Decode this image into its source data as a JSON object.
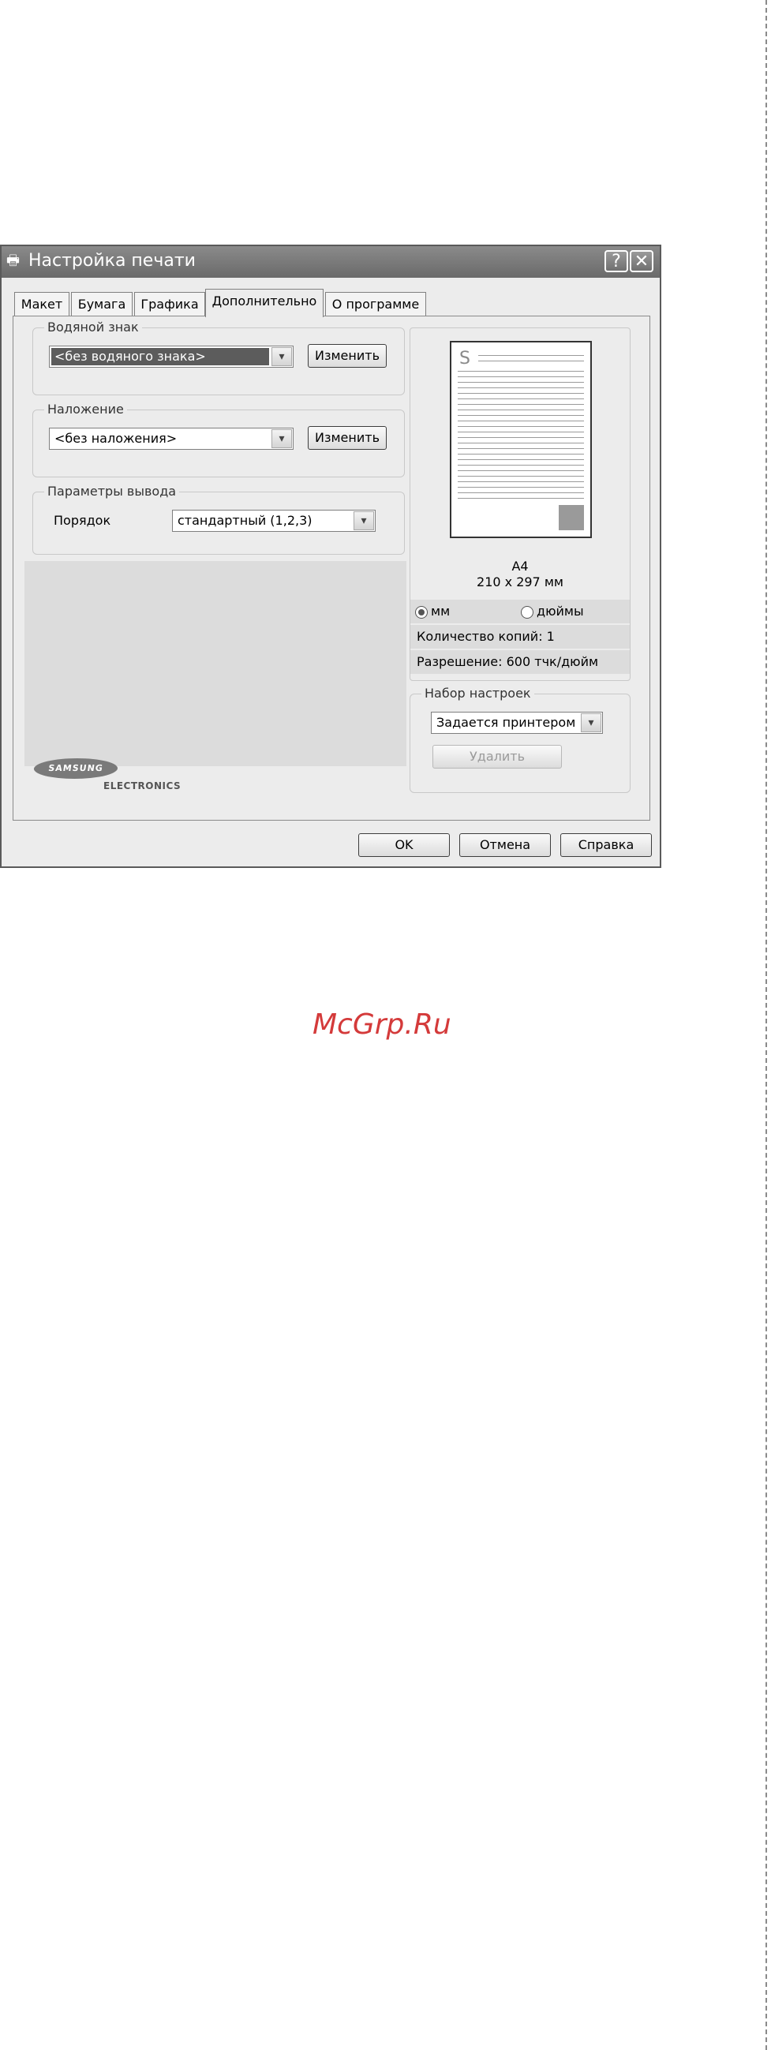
{
  "window": {
    "title": "Настройка печати",
    "help_button": "?",
    "close_button": "✕"
  },
  "tabs": [
    {
      "label": "Макет"
    },
    {
      "label": "Бумага"
    },
    {
      "label": "Графика"
    },
    {
      "label": "Дополнительно",
      "active": true
    },
    {
      "label": "О программе"
    }
  ],
  "watermark_group": {
    "label": "Водяной знак",
    "value": "<без водяного знака>",
    "edit_button": "Изменить"
  },
  "overlay_group": {
    "label": "Наложение",
    "value": "<без наложения>",
    "edit_button": "Изменить"
  },
  "output_group": {
    "label": "Параметры вывода",
    "order_label": "Порядок",
    "order_value": "стандартный (1,2,3)"
  },
  "preview": {
    "paper_name": "A4",
    "paper_size": "210 x 297 мм",
    "unit_mm": "мм",
    "unit_inches": "дюймы",
    "selected_unit": "мм",
    "copies": "Количество копий: 1",
    "resolution": "Разрешение: 600 тчк/дюйм"
  },
  "presets_group": {
    "label": "Набор настроек",
    "value": "Задается принтером",
    "delete_button": "Удалить"
  },
  "logo": {
    "brand": "SAMSUNG",
    "sub": "ELECTRONICS"
  },
  "buttons": {
    "ok": "OK",
    "cancel": "Отмена",
    "help": "Справка"
  },
  "site_watermark": "McGrp.Ru",
  "colors": {
    "site_watermark": "#d43a3a",
    "title_bar": "#7a7a7a"
  }
}
